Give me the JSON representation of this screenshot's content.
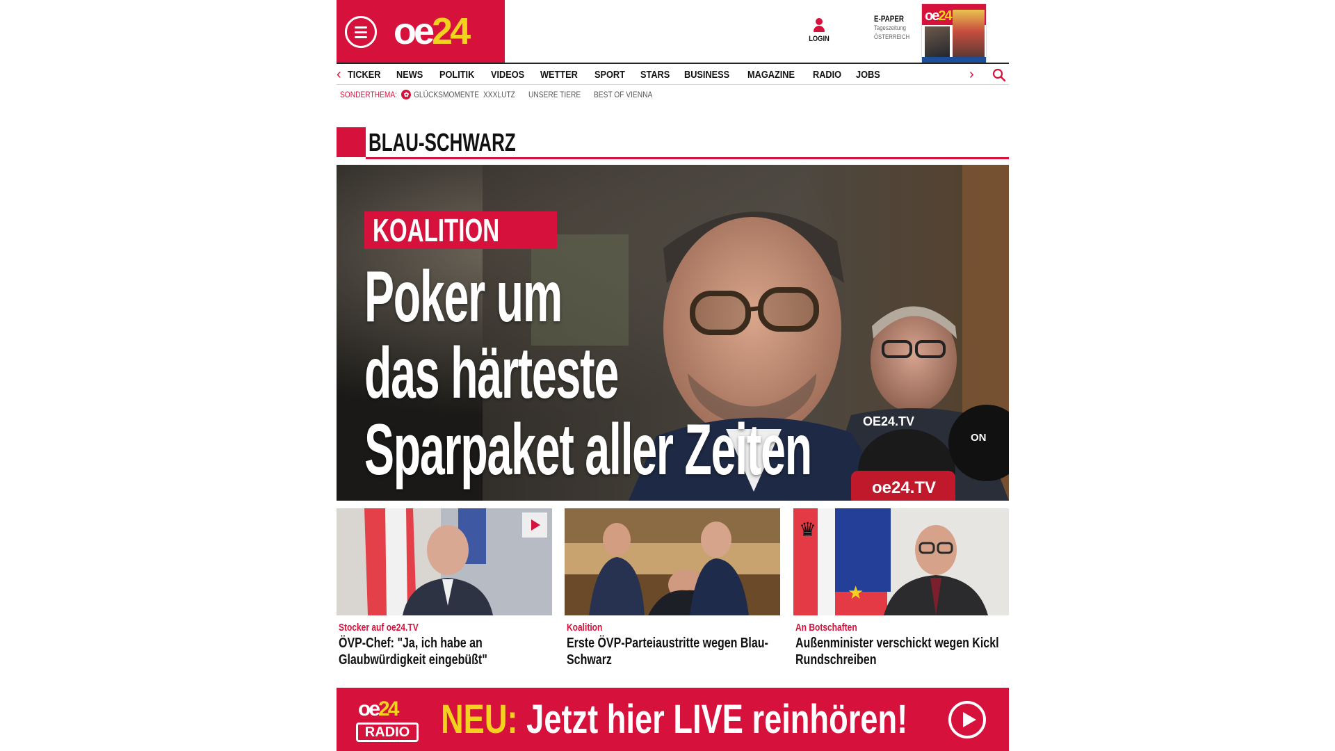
{
  "header": {
    "logo": {
      "part1": "oe",
      "part2": "24"
    },
    "login_label": "LOGIN",
    "epaper": {
      "title": "E-PAPER",
      "line1": "Tageszeitung",
      "line2": "ÖSTERREICH"
    },
    "epaper_cover_logo": {
      "part1": "oe",
      "part2": "24"
    }
  },
  "nav": {
    "items": [
      "TICKER",
      "NEWS",
      "POLITIK",
      "VIDEOS",
      "WETTER",
      "SPORT",
      "STARS",
      "BUSINESS",
      "MAGAZINE",
      "RADIO",
      "JOBS"
    ],
    "left_arrow": "‹",
    "right_arrow": "›"
  },
  "subnav": {
    "label": "SONDERTHEMA:",
    "items": [
      "GLÜCKSMOMENTE",
      "XXXLUTZ",
      "UNSERE TIERE",
      "BEST OF VIENNA"
    ]
  },
  "section": {
    "title": "BLAU-SCHWARZ"
  },
  "hero": {
    "kicker": "KOALITION",
    "title_lines": [
      "Poker um",
      "das härteste",
      "Sparpaket aller Zeiten"
    ],
    "mic_labels": [
      "OE24.TV",
      "oe24.TV",
      "ON"
    ]
  },
  "teasers": [
    {
      "kicker": "Stocker auf oe24.TV",
      "title": "ÖVP-Chef: \"Ja, ich habe an Glaubwürdigkeit eingebüßt\"",
      "has_video": true
    },
    {
      "kicker": "Koalition",
      "title": "Erste ÖVP-Parteiaustritte wegen Blau-Schwarz",
      "has_video": false
    },
    {
      "kicker": "An Botschaften",
      "title": "Außenminister verschickt wegen Kickl Rundschreiben",
      "has_video": false
    }
  ],
  "radio_banner": {
    "logo": {
      "part1": "oe",
      "part2": "24",
      "label": "RADIO"
    },
    "neu": "NEU:",
    "text": "Jetzt hier LIVE reinhören!"
  },
  "colors": {
    "brand_red": "#d5113c",
    "brand_yellow": "#f3d21f"
  }
}
